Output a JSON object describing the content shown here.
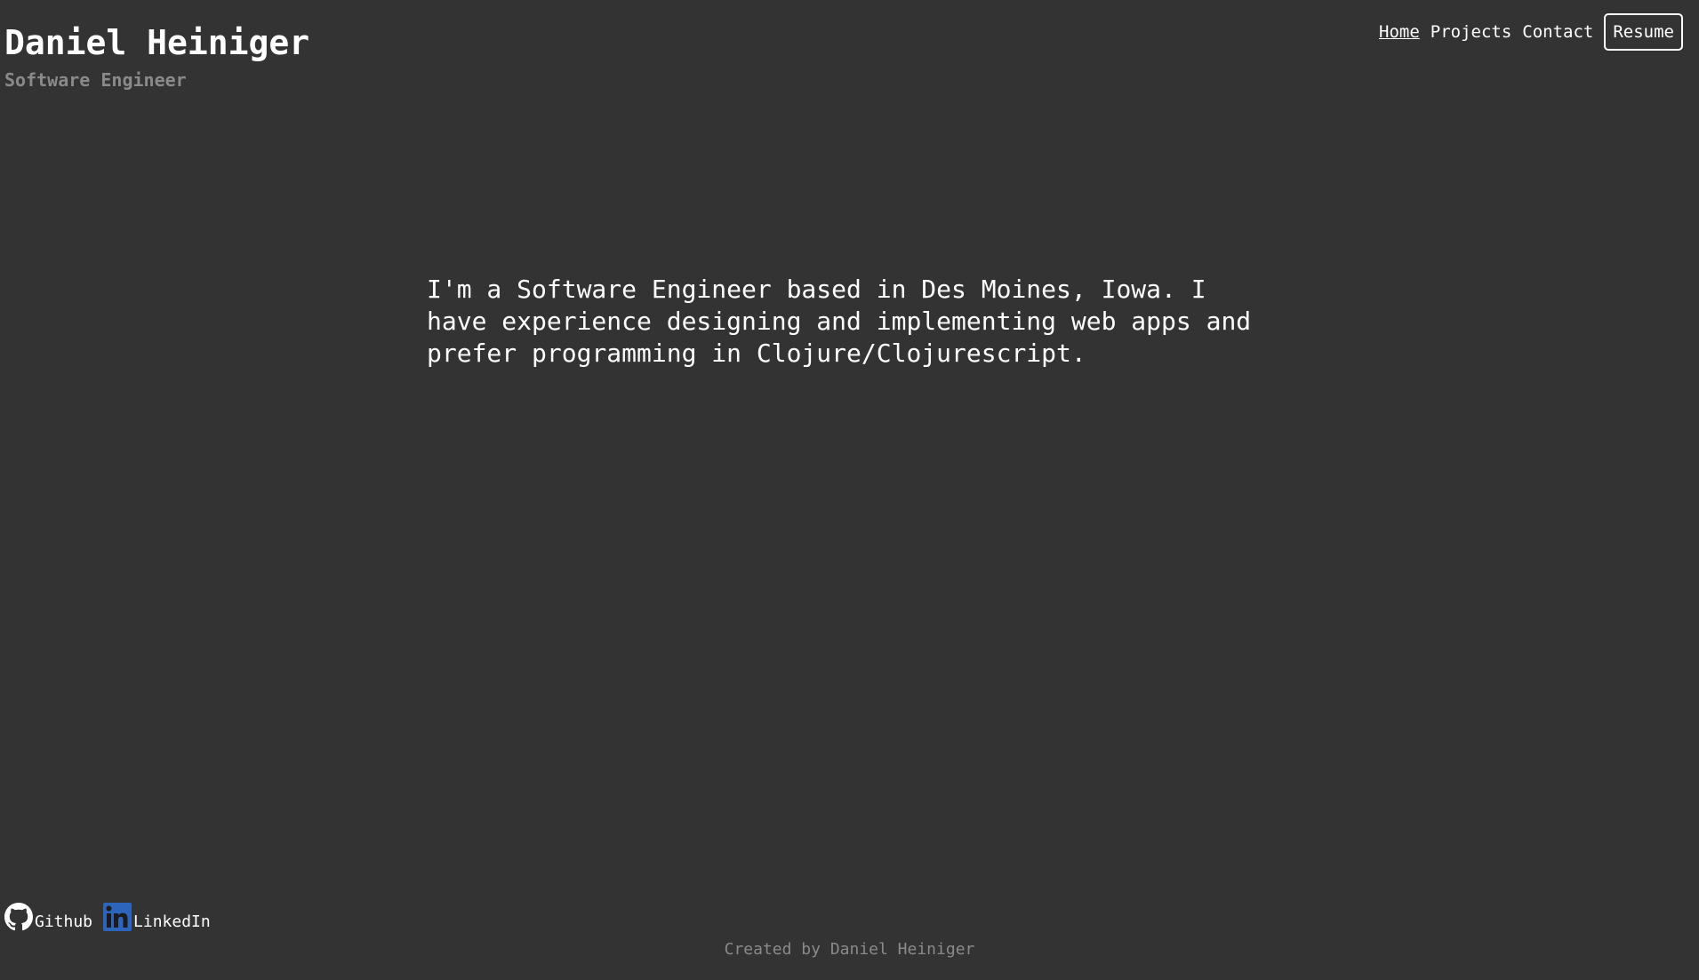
{
  "header": {
    "name": "Daniel Heiniger",
    "subtitle": "Software Engineer"
  },
  "nav": {
    "items": [
      {
        "label": "Home",
        "active": true
      },
      {
        "label": "Projects"
      },
      {
        "label": "Contact"
      }
    ],
    "resume_label": "Resume"
  },
  "main": {
    "intro": "I'm a Software Engineer based in Des Moines, Iowa. I have experience designing and implementing web apps and prefer programming in Clojure/Clojurescript."
  },
  "social": {
    "github": {
      "label": "Github",
      "icon": "github-icon"
    },
    "linkedin": {
      "label": "LinkedIn",
      "icon": "linkedin-icon",
      "color": "#2d64bc"
    }
  },
  "footer": {
    "credit": "Created by Daniel Heiniger"
  }
}
